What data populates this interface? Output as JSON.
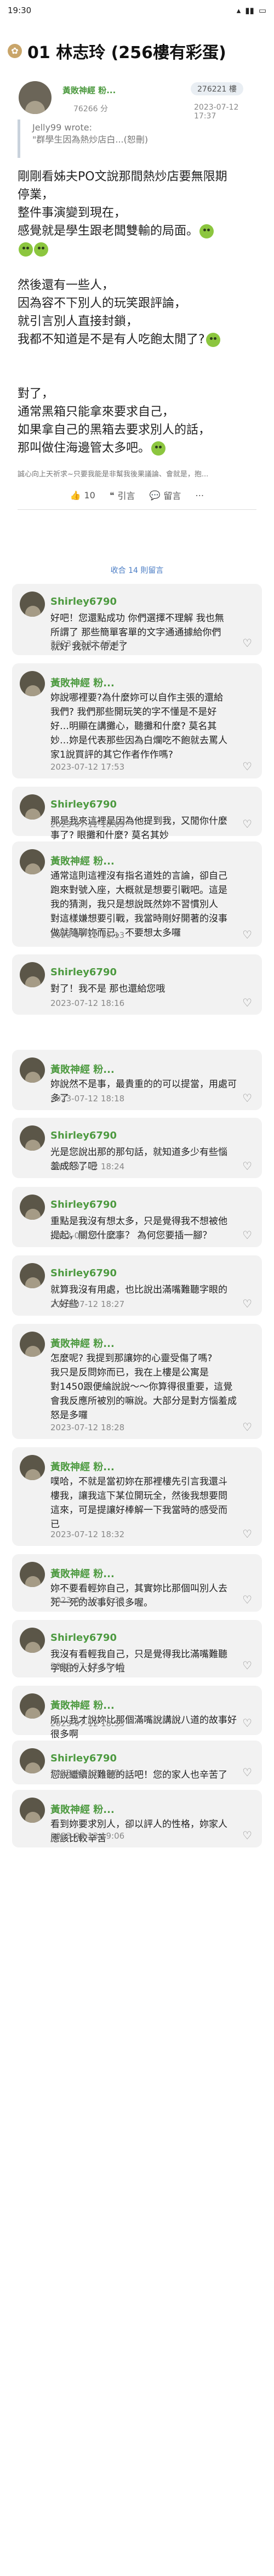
{
  "status": {
    "time": "19:30",
    "icons": "◉ ▮"
  },
  "header": {
    "back": "←",
    "badge": "帖",
    "title": "01 林志玲 (256樓有彩蛋)"
  },
  "post": {
    "author": "黃敗神經 粉...",
    "badge": "276221 樓",
    "author_id": "76266 分",
    "date": "2023-07-12 17:37",
    "quote_author": "Jelly99 wrote:",
    "quote_text": "\"群學生因為熱炒店白...(恕刪)",
    "body_lines": [
      "剛剛看姊夫PO文說那間熱炒店要無限期",
      "停業，",
      "整件事演變到現在，",
      "感覺就是學生跟老闆雙輸的局面。",
      "",
      "",
      "然後還有一些人，",
      "因為容不下別人的玩笑跟評論，",
      "就引言別人直接封鎖，",
      "我都不知道是不是有人吃飽太閒了?",
      "",
      "",
      "對了，",
      "通常黑箱只能拿來要求自己，",
      "如果拿自己的黑箱去要求別人的話，",
      "那叫做住海邊管太多吧。"
    ],
    "signature": "誠心向上天祈求~只要我能是非幫我後果議論、會就是，抱...",
    "like_count": "10",
    "quote_label": "引言",
    "reply_label": "留言",
    "reply_count_label": "收合 14 則留言"
  },
  "replies": [
    {
      "name": "Shirley6790",
      "text": [
        "好吧！您還點成功 你們選擇不理解 我也無",
        "所謂了 那些簡單客單的文字通通據給你們",
        "就好 我就不帶走了"
      ],
      "date": "2023-07-12 17:47"
    },
    {
      "name": "黃敗神經 粉...",
      "text": [
        "妳說哪裡要?為什麼妳可以自作主張的還給",
        "我們? 我們那些開玩笑的字不懂是不是好",
        "好…明顯在講攤心，聽攤和什麼? 莫名其",
        "妙…妳是代表那些因為白爛吃不飽就去罵人",
        "家1說買評的其它作者作作嗎?"
      ],
      "date": "2023-07-12 17:53"
    },
    {
      "name": "Shirley6790",
      "text": [
        "那是我來這裡是因為他提到我，又閒你什麼",
        "事了? 眼攤和什麼? 莫名其妙"
      ],
      "date": "2023-07-12 18:05"
    },
    {
      "name": "黃敗神經 粉...",
      "text": [
        "通常這則這裡沒有指名道姓的言論，卻自己",
        "跑來對號入座，大概就是想要引戰吧。這是",
        "我的猜測，我只是想說既然妳不習慣別人",
        "對這樣嫌想要引戰，我當時剛好開著的沒事",
        "做就隨聊妳而已。不要想太多囉"
      ],
      "date": "2023-07-12 18:13"
    },
    {
      "name": "Shirley6790",
      "text": [
        "對了！我不是 那也還給您哦"
      ],
      "date": "2023-07-12 18:16"
    },
    {
      "name": "黃敗神經 粉...",
      "text": [
        "妳說然不是事，最貴重的的可以提當，用處可",
        "多了"
      ],
      "date": "2023-07-12 18:18"
    },
    {
      "name": "Shirley6790",
      "text": [
        "光是您說出那的那句話，就知道多少有些惱",
        "羞成怒了吧"
      ],
      "date": "2023-07-12 18:24"
    },
    {
      "name": "Shirley6790",
      "text": [
        "重點是我沒有想太多，只是覺得我不想被他",
        "提起，關您什麼事？ 為何您要插一腳？"
      ],
      "date": "2023-07-12 18:25"
    },
    {
      "name": "Shirley6790",
      "text": [
        "就算我沒有用處，也比說出滿嘴難聽字眼的",
        "人好些"
      ],
      "date": "2023-07-12 18:27"
    },
    {
      "name": "黃敗神經 粉...",
      "text": [
        "怎麼呢? 我提到那讓妳的心靈受傷了嗎?",
        "我只是反問妳而已，我在上樓是公寓是",
        "對1450跟便綸說說～～你算得很重要，這覺",
        "會我反應所被別的嘛說。大部分是對方惱羞成",
        "怒是多囉"
      ],
      "date": "2023-07-12 18:28"
    },
    {
      "name": "黃敗神經 粉...",
      "text": [
        "噗哈，不就是當初妳在那裡樓先引言我還斗",
        "樓我，讓我這下某位開玩全，然後我想要問",
        "這來，可是提讓好棒解一下我當時的感受而",
        "已"
      ],
      "date": "2023-07-12 18:32"
    },
    {
      "name": "黃敗神經 粉...",
      "text": [
        "妳不要看輕妳自己，其實妳比那個叫別人去",
        "死一死的故事好很多喔。"
      ],
      "date": "2023-07-12 18:33"
    },
    {
      "name": "Shirley6790",
      "text": [
        "我沒有看輕我自己，只是覺得我比滿嘴難聽",
        "字眼的人好多了啦"
      ],
      "date": "2023-07-12 18:45"
    },
    {
      "name": "黃敗神經 粉...",
      "text": [
        "所以我才說妳比那個滿嘴說講說八道的故事好",
        "很多啊"
      ],
      "date": "2023-07-12 18:53"
    },
    {
      "name": "Shirley6790",
      "text": [
        "您說繼續說難聽的話吧！您的家人也辛苦了"
      ],
      "date": "2023-07-12 18:56"
    },
    {
      "name": "黃敗神經 粉...",
      "text": [
        "看到妳要求別人，卻以評人的性格，妳家人",
        "應該比較辛苦"
      ],
      "date": "2023-07-12 19:06"
    }
  ]
}
